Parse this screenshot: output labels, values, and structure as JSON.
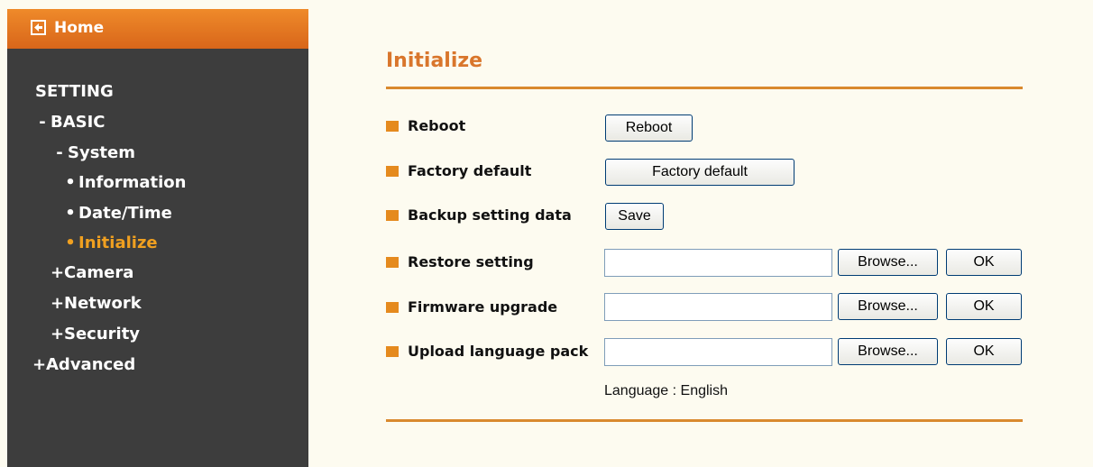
{
  "sidebar": {
    "home_label": "Home",
    "items": [
      {
        "symbol": "",
        "label": "SETTING"
      },
      {
        "symbol": "-",
        "label": "BASIC"
      },
      {
        "symbol": "-",
        "label": "System"
      },
      {
        "symbol": "•",
        "label": "Information"
      },
      {
        "symbol": "•",
        "label": "Date/Time"
      },
      {
        "symbol": "•",
        "label": "Initialize"
      },
      {
        "symbol": "+",
        "label": "Camera"
      },
      {
        "symbol": "+",
        "label": "Network"
      },
      {
        "symbol": "+",
        "label": "Security"
      },
      {
        "symbol": "+",
        "label": "Advanced"
      }
    ],
    "active_item": "Initialize"
  },
  "main": {
    "title": "Initialize",
    "rows": [
      {
        "label": "Reboot",
        "button": "Reboot"
      },
      {
        "label": "Factory default",
        "button": "Factory default"
      },
      {
        "label": "Backup setting data",
        "button": "Save"
      },
      {
        "label": "Restore setting",
        "browse": "Browse...",
        "ok": "OK",
        "value": ""
      },
      {
        "label": "Firmware upgrade",
        "browse": "Browse...",
        "ok": "OK",
        "value": ""
      },
      {
        "label": "Upload language pack",
        "browse": "Browse...",
        "ok": "OK",
        "value": ""
      }
    ],
    "language_note": "Language : English"
  },
  "colors": {
    "accent": "#d9762c",
    "sidebar_bg": "#3d3d3d",
    "active_nav": "#f0a020",
    "page_bg": "#fdfbf0"
  }
}
